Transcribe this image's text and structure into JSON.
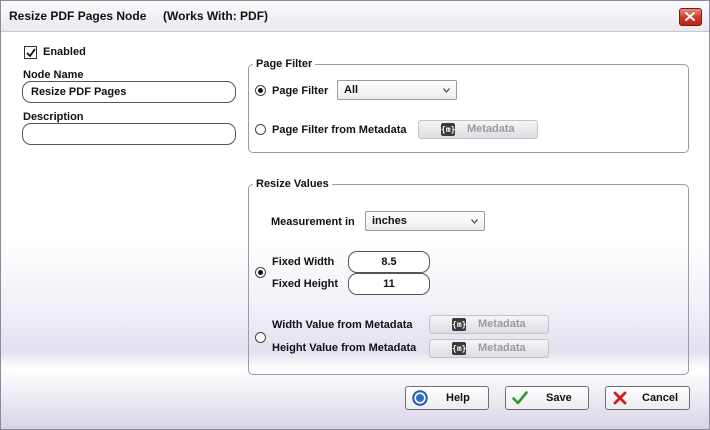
{
  "window": {
    "title": "Resize PDF Pages Node     (Works With: PDF)"
  },
  "enabled": {
    "label": "Enabled",
    "checked": true
  },
  "node_name": {
    "label": "Node Name",
    "value": "Resize PDF Pages"
  },
  "description": {
    "label": "Description",
    "value": ""
  },
  "page_filter": {
    "group_title": "Page Filter",
    "option_filter_label": "Page Filter",
    "option_filter_selected": true,
    "filter_value": "All",
    "option_metadata_label": "Page Filter from Metadata",
    "metadata_button_icon": "{m}",
    "metadata_button_label": "Metadata"
  },
  "resize_values": {
    "group_title": "Resize Values",
    "measurement_label": "Measurement in",
    "measurement_value": "inches",
    "fixed_selected": true,
    "fixed_width_label": "Fixed Width",
    "fixed_width_value": "8.5",
    "fixed_height_label": "Fixed Height",
    "fixed_height_value": "11",
    "width_metadata_label": "Width Value from Metadata",
    "height_metadata_label": "Height Value from Metadata",
    "metadata_button_icon": "{m}",
    "metadata_button_label": "Metadata"
  },
  "buttons": {
    "help": "Help",
    "save": "Save",
    "cancel": "Cancel"
  },
  "colors": {
    "close_button": "#c9392a",
    "help_icon": "#2a6fc9",
    "save_check": "#2e9a2e",
    "cancel_x": "#d11a1a"
  }
}
